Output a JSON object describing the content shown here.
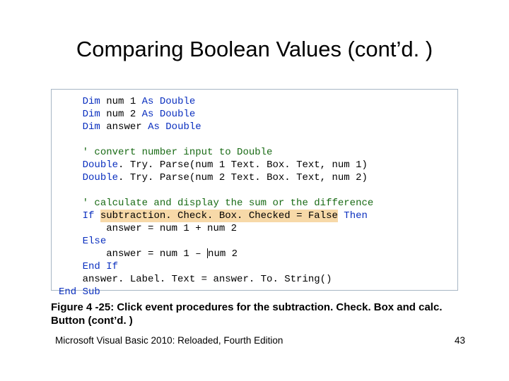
{
  "title": "Comparing Boolean Values (cont’d. )",
  "code": {
    "dim": "Dim",
    "as": "As",
    "double": "Double",
    "num1": "num 1",
    "num2": "num 2",
    "answer": "answer",
    "comment1": "' convert number input to Double",
    "parse1": ". Try. Parse(num 1 Text. Box. Text, num 1)",
    "parse2": ". Try. Parse(num 2 Text. Box. Text, num 2)",
    "comment2": "' calculate and display the sum or the difference",
    "if": "If",
    "then": "Then",
    "cond": "subtraction. Check. Box. Checked = False",
    "assign_add": "answer = num 1 + num 2",
    "else": "Else",
    "assign_sub": "answer = num 1 – ",
    "assign_sub_tail": "num 2",
    "endif": "End",
    "endif2": "If",
    "label_line": "answer. Label. Text = answer. To. String()",
    "endsub": "End",
    "endsub2": "Sub"
  },
  "caption": "Figure 4 -25: Click event procedures for the subtraction. Check. Box and calc. Button (cont’d. )",
  "footer_left": "Microsoft Visual Basic 2010: Reloaded, Fourth Edition",
  "page_number": "43"
}
